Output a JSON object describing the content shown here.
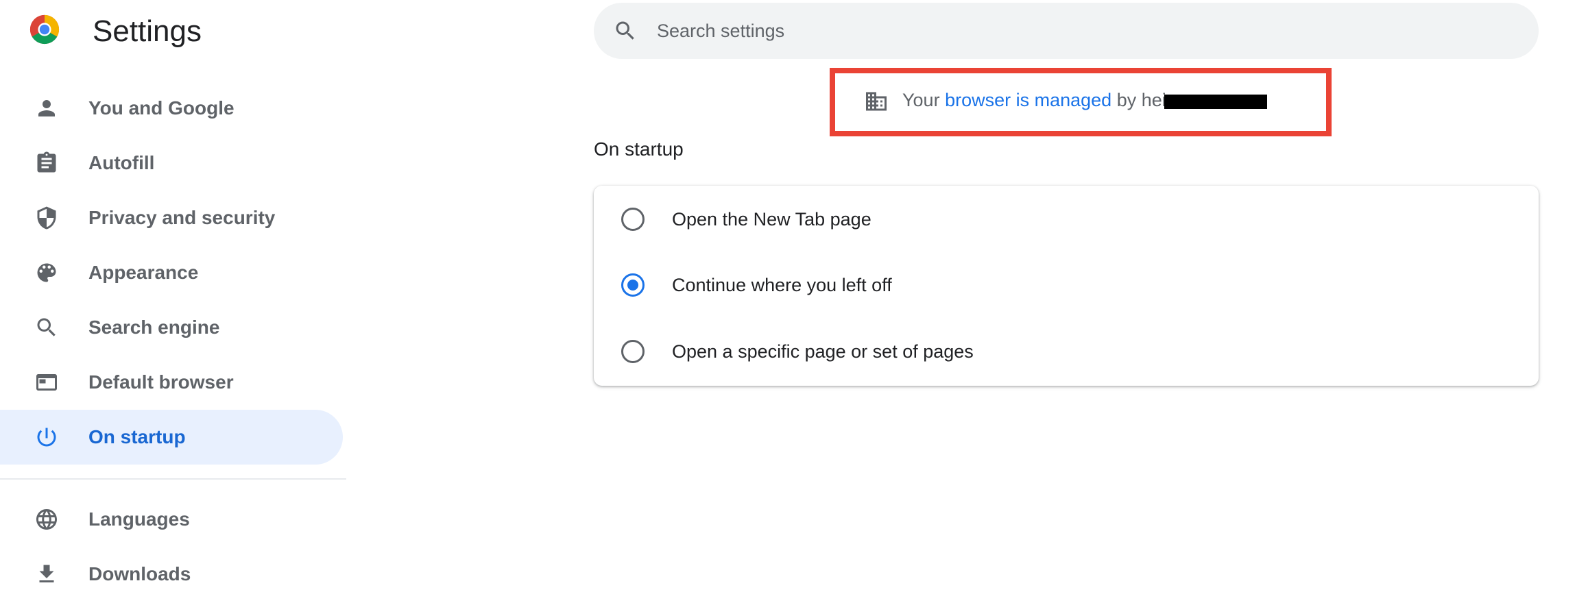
{
  "header": {
    "app_title": "Settings"
  },
  "sidebar": {
    "items": [
      {
        "label": "You and Google",
        "icon": "person-icon",
        "active": false
      },
      {
        "label": "Autofill",
        "icon": "clipboard-icon",
        "active": false
      },
      {
        "label": "Privacy and security",
        "icon": "shield-icon",
        "active": false
      },
      {
        "label": "Appearance",
        "icon": "palette-icon",
        "active": false
      },
      {
        "label": "Search engine",
        "icon": "search-icon",
        "active": false
      },
      {
        "label": "Default browser",
        "icon": "browser-window-icon",
        "active": false
      },
      {
        "label": "On startup",
        "icon": "power-icon",
        "active": true
      },
      {
        "label": "Languages",
        "icon": "globe-icon",
        "active": false
      },
      {
        "label": "Downloads",
        "icon": "download-icon",
        "active": false
      }
    ]
  },
  "search": {
    "placeholder": "Search settings",
    "value": ""
  },
  "managed": {
    "prefix": "Your ",
    "link": "browser is managed",
    "suffix": " by heis",
    "icon": "building-icon"
  },
  "startup": {
    "title": "On startup",
    "options": [
      {
        "label": "Open the New Tab page",
        "checked": false
      },
      {
        "label": "Continue where you left off",
        "checked": true
      },
      {
        "label": "Open a specific page or set of pages",
        "checked": false
      }
    ]
  },
  "colors": {
    "accent": "#1a73e8",
    "active_bg": "#e8f0fe",
    "highlight_box": "#ea4335",
    "icon_gray": "#5f6368"
  }
}
